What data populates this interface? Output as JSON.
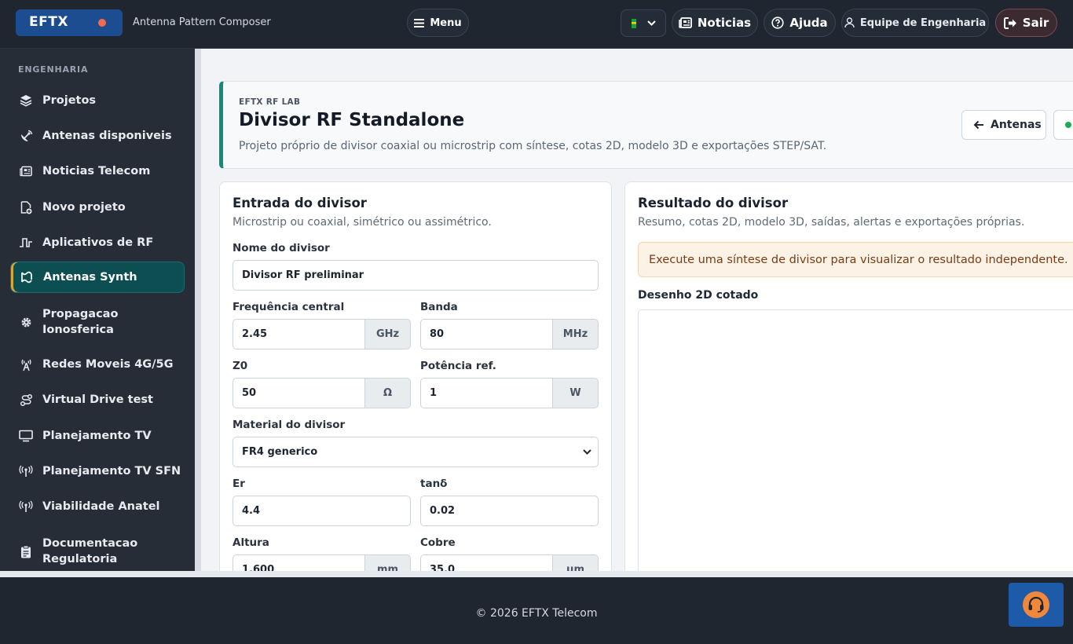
{
  "header": {
    "brand": "EFTX",
    "app_name": "Antenna Pattern Composer",
    "menu_label": "Menu",
    "news_label": "Noticias",
    "help_label": "Ajuda",
    "team_label": "Equipe de Engenharia",
    "exit_label": "Sair",
    "language_flag_icon": "brazil-flag-icon"
  },
  "sidebar": {
    "section": "ENGENHARIA",
    "items": [
      {
        "label": "Projetos",
        "icon": "layers-icon"
      },
      {
        "label": "Antenas disponiveis",
        "icon": "satellite-dish-icon"
      },
      {
        "label": "Noticias Telecom",
        "icon": "newspaper-icon"
      },
      {
        "label": "Novo projeto",
        "icon": "file-plus-icon"
      },
      {
        "label": "Aplicativos de RF",
        "icon": "pulse-icon"
      },
      {
        "label": "Antenas Synth",
        "icon": "synth-icon",
        "active": true
      },
      {
        "label": "Propagacao Ionosferica",
        "icon": "gear-icon"
      },
      {
        "label": "Redes Moveis 4G/5G",
        "icon": "cell-tower-icon"
      },
      {
        "label": "Virtual Drive test",
        "icon": "route-icon"
      },
      {
        "label": "Planejamento TV",
        "icon": "monitor-icon"
      },
      {
        "label": "Planejamento TV SFN",
        "icon": "broadcast-icon"
      },
      {
        "label": "Viabilidade Anatel",
        "icon": "broadcast-icon"
      },
      {
        "label": "Documentacao Regulatoria",
        "icon": "clipboard-icon"
      }
    ]
  },
  "hero": {
    "eyebrow": "EFTX RF LAB",
    "title": "Divisor RF Standalone",
    "subtitle": "Projeto próprio de divisor coaxial ou microstrip com síntese, cotas 2D, modelo 3D e exportações STEP/SAT.",
    "back_label": "Antenas"
  },
  "input_card": {
    "title": "Entrada do divisor",
    "subtitle": "Microstrip ou coaxial, simétrico ou assimétrico.",
    "name_label": "Nome do divisor",
    "name_value": "Divisor RF preliminar",
    "freq_label": "Frequência central",
    "freq_value": "2.45",
    "freq_unit": "GHz",
    "band_label": "Banda",
    "band_value": "80",
    "band_unit": "MHz",
    "z0_label": "Z0",
    "z0_value": "50",
    "z0_unit": "Ω",
    "power_label": "Potência ref.",
    "power_value": "1",
    "power_unit": "W",
    "material_label": "Material do divisor",
    "material_value": "FR4 generico",
    "er_label": "Er",
    "er_value": "4.4",
    "tand_label": "tanδ",
    "tand_value": "0.02",
    "height_label": "Altura",
    "height_value": "1.600",
    "height_unit": "mm",
    "copper_label": "Cobre",
    "copper_value": "35.0",
    "copper_unit": "µm"
  },
  "result_card": {
    "title": "Resultado do divisor",
    "subtitle": "Resumo, cotas 2D, modelo 3D, saídas, alertas e exportações próprias.",
    "alert": "Execute uma síntese de divisor para visualizar o resultado independente.",
    "drawing_title": "Desenho 2D cotado"
  },
  "footer": {
    "copyright": "© 2026 EFTX Telecom"
  },
  "colors": {
    "topbar": "#1f2630",
    "sidebar": "#262d37",
    "accent_teal": "#138a7e",
    "brand_blue": "#1d4d91",
    "support_orange": "#f0883c"
  }
}
